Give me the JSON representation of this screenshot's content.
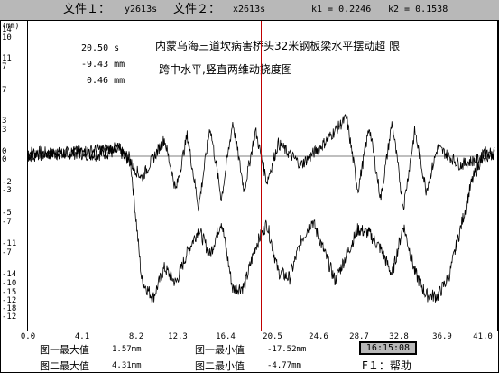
{
  "header": {
    "file1_label": "文件１：",
    "file1_value": "y2613s",
    "file2_label": "文件２：",
    "file2_value": "x2613s",
    "k1": "k1 = 0.2246",
    "k2": "k2 = 0.1538"
  },
  "chart": {
    "units_label": "(mm)",
    "title_line1": "内蒙乌海三道坎病害桥头32米钢板梁水平摆动超 限",
    "title_line2": "跨中水平,竖直两维动挠度图",
    "readout_time": "20.50  s",
    "readout_value1": "-9.43 mm",
    "readout_value2": "0.46 mm",
    "cursor_color": "#c00000"
  },
  "chart_data": {
    "type": "line",
    "xlabel": "",
    "ylabel": "(mm)",
    "xlim": [
      0.0,
      41.0
    ],
    "x_ticks": [
      "0.0",
      "4.1",
      "8.2",
      "12.3",
      "16.4",
      "20.5",
      "24.6",
      "28.7",
      "32.8",
      "36.9",
      "41.0"
    ],
    "y_tick_labels_upper": [
      "14",
      "10",
      "11",
      "7",
      "7",
      "3",
      "3",
      "0",
      "0"
    ],
    "y_tick_labels_lower": [
      "-2",
      "-3",
      "-5",
      "-7",
      "-11",
      "-7",
      "-14",
      "-10",
      "-15",
      "-12",
      "-18",
      "-12"
    ],
    "cursor_x": 20.5,
    "series": [
      {
        "name": "",
        "x": [
          0,
          2,
          4,
          6,
          8,
          9,
          10,
          11,
          12,
          13,
          14,
          15,
          16,
          17,
          18,
          19,
          20,
          21,
          22,
          23,
          24,
          25,
          26,
          27,
          28,
          29,
          30,
          31,
          32,
          33,
          34,
          35,
          36,
          37,
          38,
          39,
          40,
          41
        ],
        "y": [
          0.5,
          0.3,
          0.4,
          0.2,
          0.6,
          -0.3,
          -14.5,
          -16.5,
          -13,
          -14.8,
          -11.2,
          -8.5,
          -11.5,
          -7.5,
          -15.5,
          -15.2,
          -10.5,
          -7.8,
          -13.5,
          -14.2,
          -9.8,
          -7.5,
          -11,
          -14.5,
          -11.5,
          -8.5,
          -9,
          -10.8,
          -13.8,
          -8,
          -13.5,
          -16.2,
          -16.3,
          -14,
          -8.5,
          -3,
          0.3,
          0.4
        ]
      },
      {
        "name": "",
        "x": [
          0,
          4,
          8,
          10,
          12,
          13,
          14,
          15,
          16,
          17,
          18,
          19,
          20,
          21,
          22,
          24,
          26,
          28,
          29,
          30,
          31,
          32,
          33,
          34,
          35,
          36,
          38,
          41
        ],
        "y": [
          0,
          0.5,
          1,
          -2.5,
          2,
          -4,
          2.5,
          -6,
          3.5,
          -5,
          4,
          -4,
          3,
          -3,
          1.5,
          -1,
          1.5,
          4.5,
          -4,
          3.5,
          -5,
          4,
          -6,
          3,
          -4,
          1,
          -1,
          0.3
        ]
      }
    ]
  },
  "footer": {
    "max1_label": "图一最大值",
    "max1_value": "1.57mm",
    "min1_label": "图一最小值",
    "min1_value": "-17.52mm",
    "max2_label": "图二最大值",
    "max2_value": "4.31mm",
    "min2_label": "图二最小值",
    "min2_value": "-4.77mm",
    "clock": "16:15:08",
    "help": "F１：帮助"
  }
}
